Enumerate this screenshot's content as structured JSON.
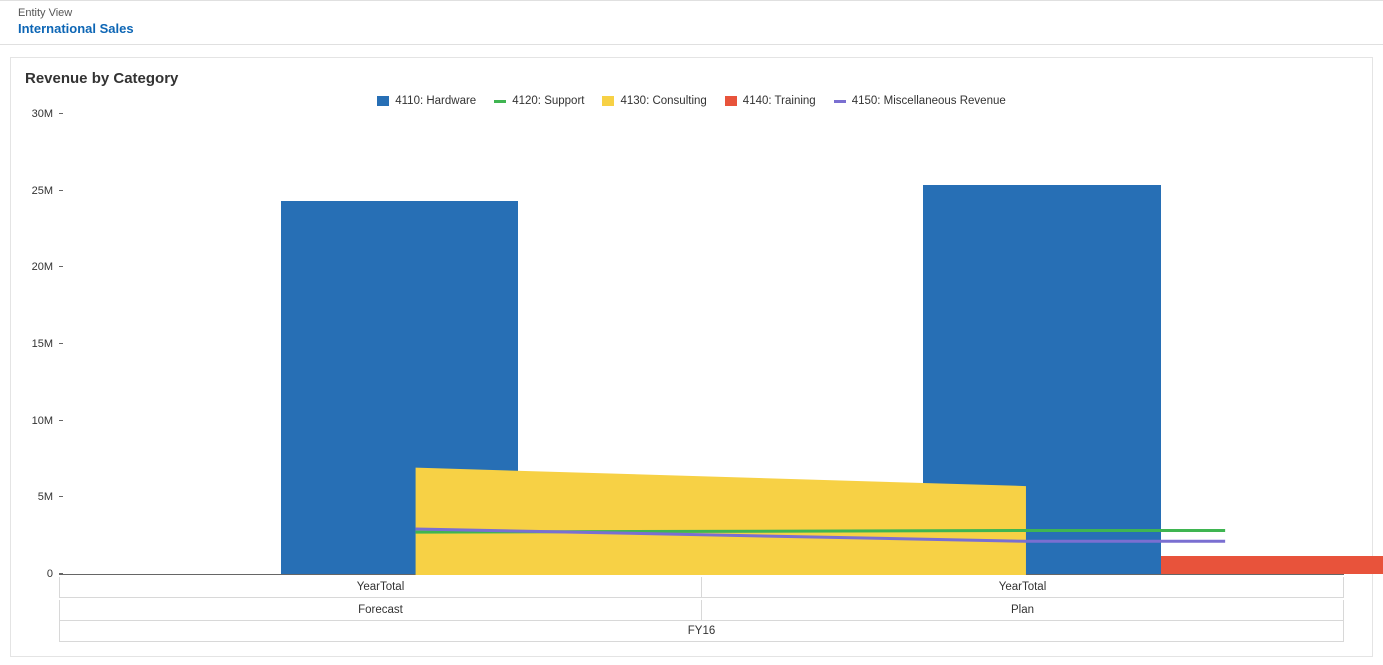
{
  "header": {
    "breadcrumb": "Entity View",
    "title": "International Sales"
  },
  "chart_data": {
    "type": "bar",
    "title": "Revenue by Category",
    "ylabel": "",
    "ylim": [
      0,
      30000000
    ],
    "yticks": [
      0,
      5000000,
      10000000,
      15000000,
      20000000,
      25000000,
      30000000
    ],
    "ytick_labels": [
      "0",
      "5M",
      "10M",
      "15M",
      "20M",
      "25M",
      "30M"
    ],
    "categories": [
      "YearTotal",
      "YearTotal"
    ],
    "category_groups": [
      "Forecast",
      "Plan"
    ],
    "category_parent": "FY16",
    "series": [
      {
        "name": "4110: Hardware",
        "color": "#276fb5",
        "render": "bar",
        "position": "primary",
        "values": [
          24300000,
          25400000
        ]
      },
      {
        "name": "4120: Support",
        "color": "#3fb551",
        "render": "line",
        "values": [
          2800000,
          2900000
        ]
      },
      {
        "name": "4130: Consulting",
        "color": "#f7d145",
        "render": "area",
        "values": [
          7000000,
          5800000
        ]
      },
      {
        "name": "4140: Training",
        "color": "#e8533b",
        "render": "bar",
        "position": "secondary",
        "values": [
          1100000,
          1200000
        ]
      },
      {
        "name": "4150: Miscellaneous Revenue",
        "color": "#7a6fd1",
        "render": "line",
        "values": [
          3000000,
          2200000
        ]
      }
    ]
  },
  "colors": {
    "hardware": "#276fb5",
    "support": "#3fb551",
    "consulting": "#f7d145",
    "training": "#e8533b",
    "misc": "#7a6fd1"
  }
}
